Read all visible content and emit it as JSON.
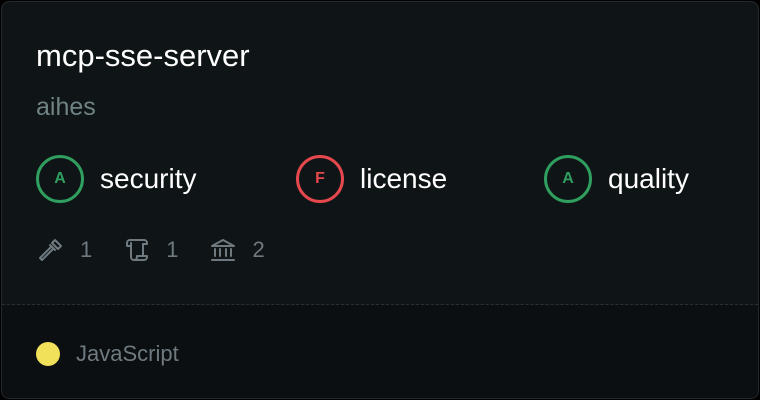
{
  "repo": {
    "name": "mcp-sse-server",
    "owner": "aihes"
  },
  "scores": [
    {
      "grade": "A",
      "label": "security",
      "color": "#2f9e5e"
    },
    {
      "grade": "F",
      "label": "license",
      "color": "#e5484d"
    },
    {
      "grade": "A",
      "label": "quality",
      "color": "#2f9e5e"
    }
  ],
  "stats": [
    {
      "icon": "hammer-icon",
      "count": "1"
    },
    {
      "icon": "scroll-icon",
      "count": "1"
    },
    {
      "icon": "bank-icon",
      "count": "2"
    }
  ],
  "language": {
    "name": "JavaScript",
    "color": "#f1e05a"
  },
  "colors": {
    "card_background": "#0f1417",
    "footer_background": "#0b0f12",
    "muted_text": "#6e7a7f",
    "owner_text": "#6f8384"
  }
}
